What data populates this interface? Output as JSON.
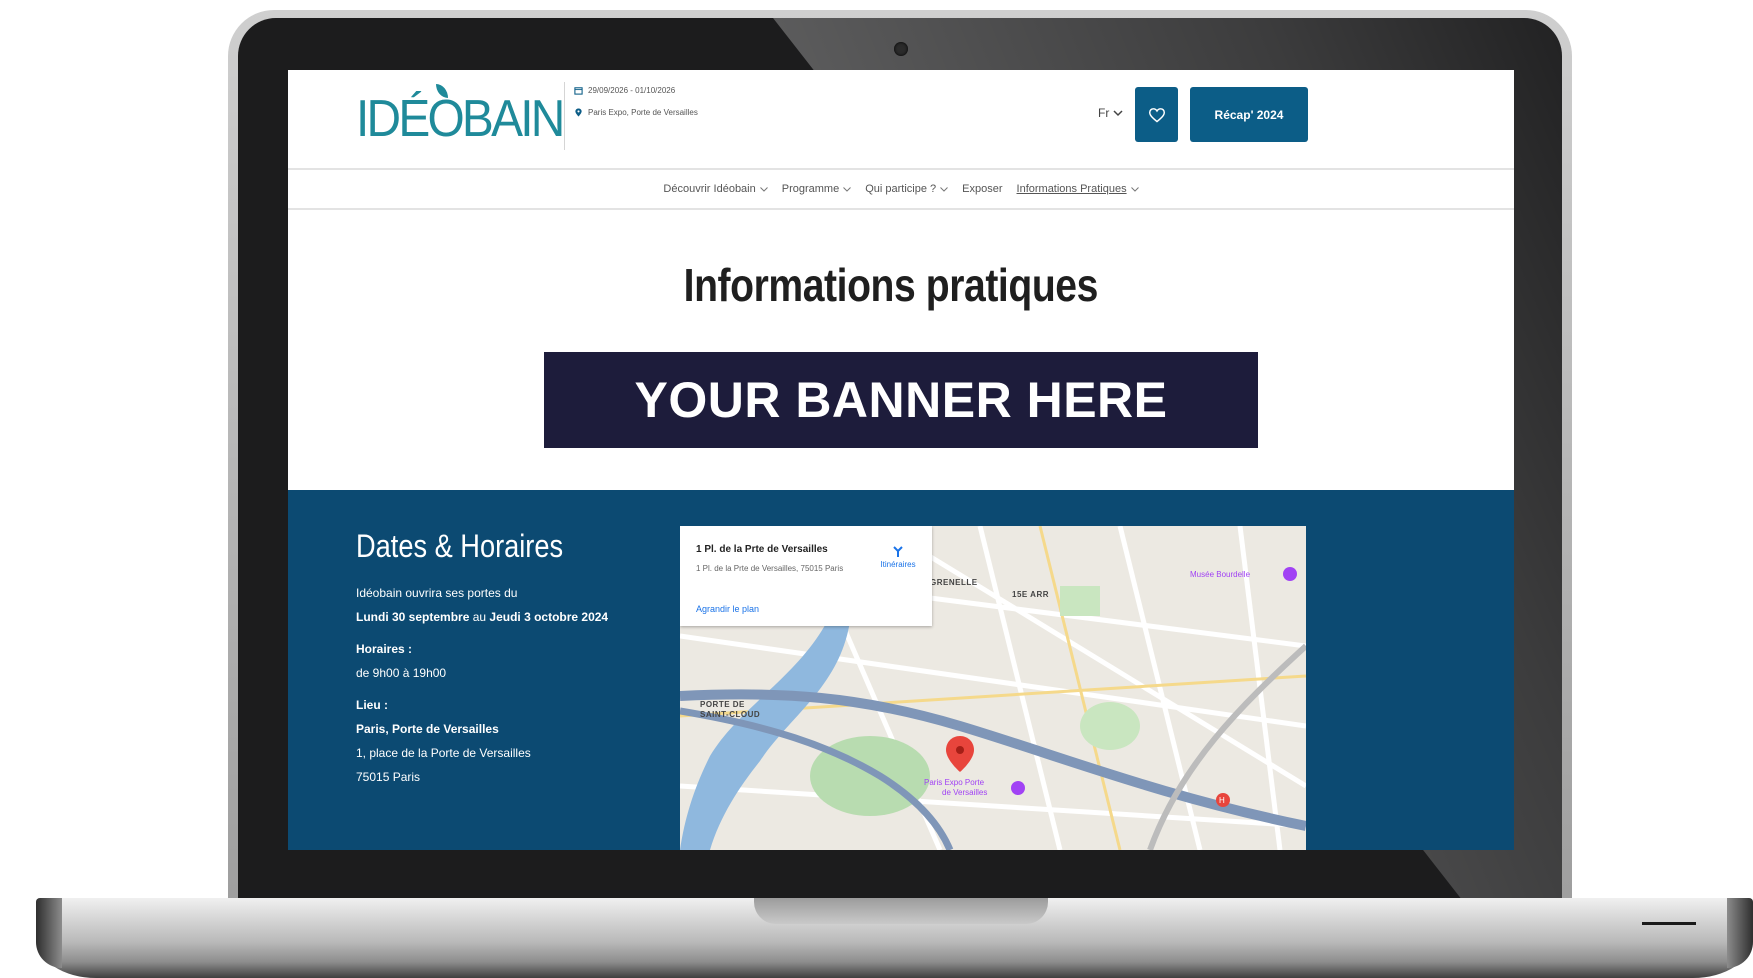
{
  "site": {
    "logo": "IDÉOBAIN",
    "event_dates": "29/09/2026 - 01/10/2026",
    "event_location": "Paris Expo, Porte de Versailles",
    "lang": "Fr",
    "recap_button": "Récap' 2024"
  },
  "nav": {
    "items": [
      {
        "label": "Découvrir Idéobain"
      },
      {
        "label": "Programme"
      },
      {
        "label": "Qui participe ?"
      },
      {
        "label": "Exposer"
      },
      {
        "label": "Informations Pratiques"
      }
    ]
  },
  "page": {
    "title": "Informations pratiques",
    "banner": "YOUR BANNER HERE"
  },
  "info": {
    "title": "Dates & Horaires",
    "opening_intro": "Idéobain ouvrira ses portes du",
    "opening_dates_start": "Lundi 30 septembre",
    "opening_dates_mid": " au ",
    "opening_dates_end": "Jeudi 3 octobre 2024",
    "hours_label": "Horaires :",
    "hours_value": "de 9h00 à 19h00",
    "place_label": "Lieu :",
    "place_name": "Paris, Porte de Versailles",
    "place_address": "1, place de la Porte de Versailles",
    "place_city": "75015 Paris"
  },
  "map": {
    "card_title": "1 Pl. de la Prte de Versailles",
    "card_address": "1 Pl. de la Prte de Versailles, 75015 Paris",
    "card_link": "Agrandir le plan",
    "directions": "Itinéraires",
    "labels": {
      "grenelle": "GRENELLE",
      "arr15": "15E ARR",
      "porte_st_cloud_1": "PORTE DE",
      "porte_st_cloud_2": "SAINT-CLOUD",
      "musee": "Musée Bourdelle",
      "paris_expo_1": "Paris Expo Porte",
      "paris_expo_2": "de Versailles"
    },
    "colors": {
      "marker": "#e8453c",
      "water": "#8fb8de",
      "park": "#b8dcb0",
      "road": "#7f96b8"
    }
  },
  "colors": {
    "brand_teal": "#1f8a9a",
    "brand_blue": "#0c5d87",
    "band_blue": "#0c4a72",
    "banner_navy": "#1d1c3b"
  }
}
